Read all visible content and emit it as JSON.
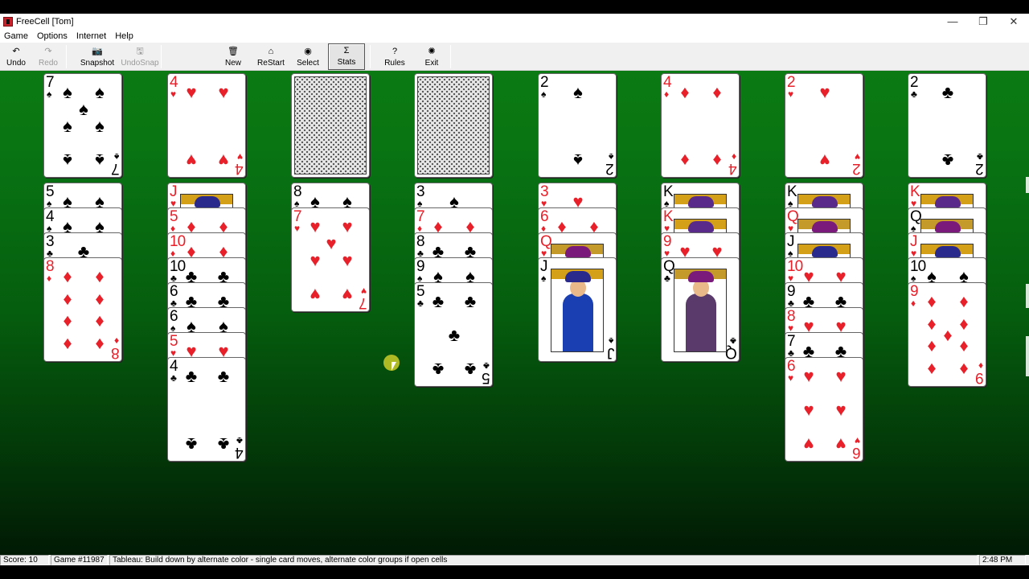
{
  "window": {
    "title": "FreeCell [Tom]",
    "minimize_icon": "minimize-icon",
    "restore_icon": "restore-icon",
    "close_icon": "close-icon",
    "minimize_glyph": "—",
    "restore_glyph": "❐",
    "close_glyph": "✕"
  },
  "menu": [
    "Game",
    "Options",
    "Internet",
    "Help"
  ],
  "toolbar": {
    "buttons": [
      {
        "label": "Undo",
        "icon": "undo-icon",
        "glyph": "↶",
        "enabled": true
      },
      {
        "label": "Redo",
        "icon": "redo-icon",
        "glyph": "↷",
        "enabled": false
      },
      {
        "label": "Snapshot",
        "icon": "camera-icon",
        "glyph": "📷",
        "enabled": true
      },
      {
        "label": "UndoSnap",
        "icon": "undo-snapshot-icon",
        "glyph": "🖫",
        "enabled": false
      },
      {
        "label": "New",
        "icon": "trash-can-icon",
        "glyph": "🗑",
        "enabled": true
      },
      {
        "label": "ReStart",
        "icon": "home-icon",
        "glyph": "⌂",
        "enabled": true
      },
      {
        "label": "Select",
        "icon": "globe-icon",
        "glyph": "◉",
        "enabled": true
      },
      {
        "label": "Stats",
        "icon": "sigma-icon",
        "glyph": "Σ",
        "enabled": true,
        "pressed": true
      },
      {
        "label": "Rules",
        "icon": "question-icon",
        "glyph": "?",
        "enabled": true
      },
      {
        "label": "Exit",
        "icon": "exit-icon",
        "glyph": "✺",
        "enabled": true
      }
    ]
  },
  "colors": {
    "felt_top": "#0b7a13",
    "felt_bottom": "#011a04",
    "red_suit": "#e8202a",
    "black_suit": "#000000"
  },
  "game": {
    "top_row": [
      {
        "rank": "7",
        "suit": "spades"
      },
      {
        "rank": "4",
        "suit": "hearts"
      },
      {
        "face_down": true
      },
      {
        "face_down": true
      },
      {
        "rank": "2",
        "suit": "spades"
      },
      {
        "rank": "4",
        "suit": "diamonds"
      },
      {
        "rank": "2",
        "suit": "hearts"
      },
      {
        "rank": "2",
        "suit": "clubs"
      }
    ],
    "columns": [
      [
        {
          "rank": "5",
          "suit": "spades"
        },
        {
          "rank": "4",
          "suit": "spades"
        },
        {
          "rank": "3",
          "suit": "clubs"
        },
        {
          "rank": "8",
          "suit": "diamonds"
        }
      ],
      [
        {
          "rank": "J",
          "suit": "hearts"
        },
        {
          "rank": "5",
          "suit": "diamonds"
        },
        {
          "rank": "10",
          "suit": "diamonds"
        },
        {
          "rank": "10",
          "suit": "clubs"
        },
        {
          "rank": "6",
          "suit": "clubs"
        },
        {
          "rank": "6",
          "suit": "spades"
        },
        {
          "rank": "5",
          "suit": "hearts"
        },
        {
          "rank": "4",
          "suit": "clubs"
        }
      ],
      [
        {
          "rank": "8",
          "suit": "spades"
        },
        {
          "rank": "7",
          "suit": "hearts"
        }
      ],
      [
        {
          "rank": "3",
          "suit": "spades"
        },
        {
          "rank": "7",
          "suit": "diamonds"
        },
        {
          "rank": "8",
          "suit": "clubs"
        },
        {
          "rank": "9",
          "suit": "spades"
        },
        {
          "rank": "5",
          "suit": "clubs"
        }
      ],
      [
        {
          "rank": "3",
          "suit": "hearts"
        },
        {
          "rank": "6",
          "suit": "diamonds"
        },
        {
          "rank": "Q",
          "suit": "hearts"
        },
        {
          "rank": "J",
          "suit": "spades"
        }
      ],
      [
        {
          "rank": "K",
          "suit": "spades"
        },
        {
          "rank": "K",
          "suit": "hearts"
        },
        {
          "rank": "9",
          "suit": "hearts"
        },
        {
          "rank": "Q",
          "suit": "clubs"
        }
      ],
      [
        {
          "rank": "K",
          "suit": "spades"
        },
        {
          "rank": "Q",
          "suit": "hearts"
        },
        {
          "rank": "J",
          "suit": "spades"
        },
        {
          "rank": "10",
          "suit": "hearts"
        },
        {
          "rank": "9",
          "suit": "clubs"
        },
        {
          "rank": "8",
          "suit": "hearts"
        },
        {
          "rank": "7",
          "suit": "clubs"
        },
        {
          "rank": "6",
          "suit": "hearts"
        }
      ],
      [
        {
          "rank": "K",
          "suit": "hearts"
        },
        {
          "rank": "Q",
          "suit": "spades"
        },
        {
          "rank": "J",
          "suit": "hearts"
        },
        {
          "rank": "10",
          "suit": "spades"
        },
        {
          "rank": "9",
          "suit": "diamonds"
        }
      ]
    ]
  },
  "status": {
    "score": "Score:  10",
    "game_number": "Game #11987",
    "hint": "Tableau: Build down by alternate color - single card moves, alternate color groups if open cells",
    "time": "2:48 PM"
  }
}
